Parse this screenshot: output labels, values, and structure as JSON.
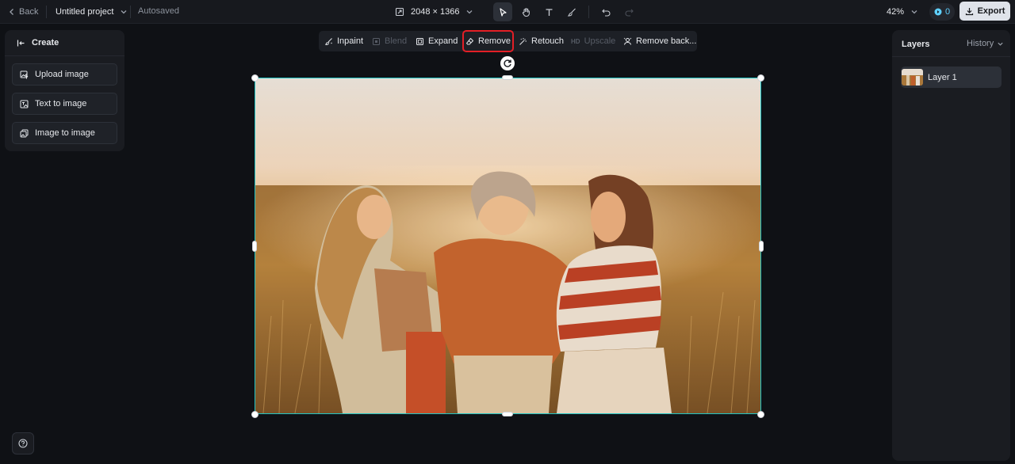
{
  "topbar": {
    "back_label": "Back",
    "project_name": "Untitled project",
    "save_status": "Autosaved",
    "dimensions": "2048 × 1366",
    "tools": [
      "select",
      "pan",
      "text",
      "brush",
      "undo",
      "redo"
    ],
    "active_tool": "select",
    "zoom": "42%",
    "credits": "0",
    "export_label": "Export"
  },
  "create_panel": {
    "title": "Create",
    "items": [
      {
        "label": "Upload image",
        "icon": "upload-image-icon"
      },
      {
        "label": "Text to image",
        "icon": "text-to-image-icon"
      },
      {
        "label": "Image to image",
        "icon": "image-to-image-icon"
      }
    ]
  },
  "edit_toolbar": {
    "items": [
      {
        "label": "Inpaint",
        "enabled": true,
        "highlighted": false
      },
      {
        "label": "Blend",
        "enabled": false,
        "highlighted": false
      },
      {
        "label": "Expand",
        "enabled": true,
        "highlighted": false
      },
      {
        "label": "Remove",
        "enabled": true,
        "highlighted": true
      },
      {
        "label": "Retouch",
        "enabled": true,
        "highlighted": false
      },
      {
        "label": "Upscale",
        "enabled": false,
        "highlighted": false,
        "badge": "HD"
      },
      {
        "label": "Remove back...",
        "enabled": true,
        "highlighted": false
      }
    ]
  },
  "canvas": {
    "selection_color": "#21c4c4",
    "image_description_icon": "photo-three-women-in-field"
  },
  "layers_panel": {
    "title": "Layers",
    "history_label": "History",
    "layers": [
      {
        "name": "Layer 1",
        "selected": true
      }
    ]
  },
  "colors": {
    "background": "#0f1115",
    "panel": "#1a1c21",
    "highlight_outline": "#e31f26",
    "credits_accent": "#5fd0ff"
  }
}
